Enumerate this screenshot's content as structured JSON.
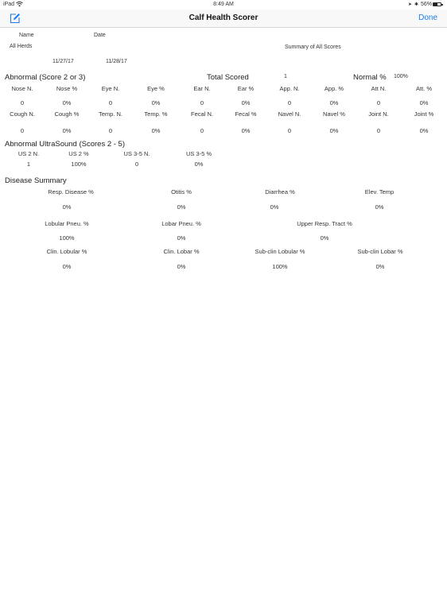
{
  "status_bar": {
    "device": "iPad",
    "time": "8:49 AM",
    "battery_text": "56%",
    "battery_level": 0.56
  },
  "nav": {
    "title": "Calf Health Scorer",
    "done_label": "Done",
    "left_icon": "compose-icon",
    "accent_color": "#1a7cf0"
  },
  "header": {
    "name_label": "Name",
    "date_label": "Date",
    "herd": "All Herds",
    "summary_title": "Summary of All Scores",
    "date_from": "11/27/17",
    "date_to": "11/28/17"
  },
  "abnormal": {
    "title": "Abnormal (Score 2 or 3)",
    "total_scored_label": "Total Scored",
    "total_scored_value": "1",
    "normal_label": "Normal %",
    "normal_value": "100%",
    "row1": [
      {
        "label": "Nose N.",
        "value": "0"
      },
      {
        "label": "Nose %",
        "value": "0%"
      },
      {
        "label": "Eye N.",
        "value": "0"
      },
      {
        "label": "Eye %",
        "value": "0%"
      },
      {
        "label": "Ear N.",
        "value": "0"
      },
      {
        "label": "Ear %",
        "value": "0%"
      },
      {
        "label": "App. N.",
        "value": "0"
      },
      {
        "label": "App. %",
        "value": "0%"
      },
      {
        "label": "Att N.",
        "value": "0"
      },
      {
        "label": "Att. %",
        "value": "0%"
      }
    ],
    "row2": [
      {
        "label": "Cough N.",
        "value": "0"
      },
      {
        "label": "Cough %",
        "value": "0%"
      },
      {
        "label": "Temp. N.",
        "value": "0"
      },
      {
        "label": "Temp. %",
        "value": "0%"
      },
      {
        "label": "Fecal N.",
        "value": "0"
      },
      {
        "label": "Fecal %",
        "value": "0%"
      },
      {
        "label": "Navel N.",
        "value": "0"
      },
      {
        "label": "Navel %",
        "value": "0%"
      },
      {
        "label": "Joint N.",
        "value": "0"
      },
      {
        "label": "Joint %",
        "value": "0%"
      }
    ]
  },
  "ultrasound": {
    "title": "Abnormal UltraSound (Scores 2 - 5)",
    "items": [
      {
        "label": "US 2 N.",
        "value": "1"
      },
      {
        "label": "US 2 %",
        "value": "100%"
      },
      {
        "label": "US 3-5 N.",
        "value": "0"
      },
      {
        "label": "US 3-5 %",
        "value": "0%"
      }
    ]
  },
  "disease": {
    "title": "Disease Summary",
    "row1": [
      {
        "label": "Resp. Disease %",
        "value": "0%"
      },
      {
        "label": "Otitis %",
        "value": "0%"
      },
      {
        "label": "Diarrhea %",
        "value": "0%"
      },
      {
        "label": "Elev. Temp",
        "value": "0%"
      }
    ],
    "row2": [
      {
        "label": "Lobular Pneu. %",
        "value": "100%"
      },
      {
        "label": "Lobar Pneu. %",
        "value": "0%"
      },
      {
        "label": "Upper Resp. Tract %",
        "value": "0%"
      }
    ],
    "row3": [
      {
        "label": "Clin. Lobular %",
        "value": "0%"
      },
      {
        "label": "Clin. Lobar %",
        "value": "0%"
      },
      {
        "label": "Sub-clin Lobular %",
        "value": "100%"
      },
      {
        "label": "Sub-clin Lobar %",
        "value": "0%"
      }
    ]
  }
}
